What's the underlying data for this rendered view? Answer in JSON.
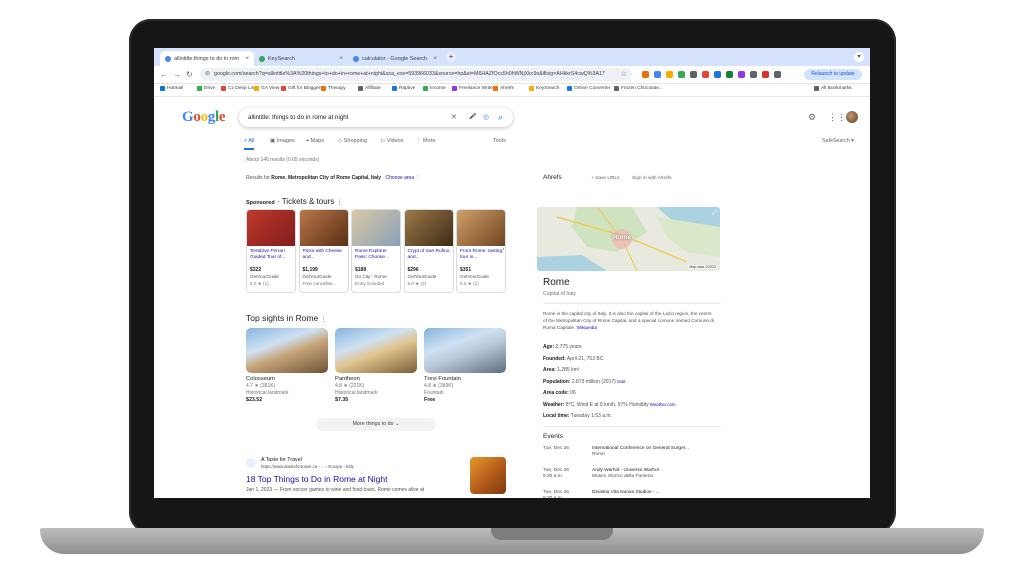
{
  "browser": {
    "tabs": [
      {
        "label": "allintitle:things to do in rom",
        "color": "#4285f4"
      },
      {
        "label": "KeySearch",
        "color": "#34a853"
      },
      {
        "label": "calculator - Google Search",
        "color": "#4285f4"
      }
    ],
    "tab_close": "×",
    "new_tab": "+",
    "url": "google.com/search?q=allintitle%3A%20things+to+do+in+rome+at+night&sca_esv=593966033&source=hp&ei=M6HAZfOcs5h0hWNjXkc9s&iflsig=AHkkrS4cwQ%3A17",
    "back": "←",
    "forward": "→",
    "reload": "↻",
    "lock": "⊜",
    "star": "☆",
    "relaunch_label": "Relaunch to update",
    "extension_colors": [
      "#e8710a",
      "#4285f4",
      "#f9ab00",
      "#34a853",
      "#5f6368",
      "#ea4335",
      "#1a73e8",
      "#188038",
      "#9334e6",
      "#5f6368",
      "#d93025",
      "#5f6368"
    ]
  },
  "bookmarks": [
    {
      "label": "Hotmail",
      "color": "#0078d4"
    },
    {
      "label": "Drive",
      "color": "#34a853"
    },
    {
      "label": "Cz Deep Link",
      "color": "#ea4335"
    },
    {
      "label": "GA View",
      "color": "#f9ab00"
    },
    {
      "label": "Gift for Bloggers",
      "color": "#ea4335"
    },
    {
      "label": "Therapy",
      "color": "#e8710a"
    },
    {
      "label": "Affiliate",
      "color": "#5f6368"
    },
    {
      "label": "Raptive",
      "color": "#1a73e8"
    },
    {
      "label": "Income",
      "color": "#34a853"
    },
    {
      "label": "Freelance Writers",
      "color": "#9334e6"
    },
    {
      "label": "Ahrefs",
      "color": "#ff6b00"
    },
    {
      "label": "KeySearch",
      "color": "#f9ab00"
    },
    {
      "label": "Online Converter",
      "color": "#1a73e8"
    },
    {
      "label": "Frozen Chocolate...",
      "color": "#5f6368"
    }
  ],
  "all_bookmarks": "All Bookmarks",
  "google": {
    "logo": [
      {
        "ch": "G",
        "c": "#4285f4"
      },
      {
        "ch": "o",
        "c": "#ea4335"
      },
      {
        "ch": "o",
        "c": "#fbbc05"
      },
      {
        "ch": "g",
        "c": "#4285f4"
      },
      {
        "ch": "l",
        "c": "#34a853"
      },
      {
        "ch": "e",
        "c": "#ea4335"
      }
    ],
    "query": "allintitle: things to do in rome at night",
    "clear_icon": "✕",
    "mic_icon": "🎤",
    "lens_icon": "◎",
    "search_icon": "⌕",
    "settings_icon": "⚙",
    "apps_icon": "⋮⋮",
    "tabs": [
      {
        "label": "All",
        "active": true
      },
      {
        "label": "Images"
      },
      {
        "label": "Maps"
      },
      {
        "label": "Shopping"
      },
      {
        "label": "Videos"
      },
      {
        "label": "More"
      }
    ],
    "tools": "Tools",
    "safesearch": "SafeSearch ▾",
    "stats": "About 146 results (0.65 seconds)",
    "results_for_prefix": "Results for ",
    "results_for_place": "Rome, Metropolitan City of Rome Capital, Italy",
    "choose_area": "Choose area",
    "sponsored_label": "Sponsored",
    "tickets_title": "Tickets & tours",
    "tickets": [
      {
        "title": "Testdrive Ferrari Guided Tour of...",
        "price": "$322",
        "vendor": "GetYourGuide",
        "rating": "5.0 ★ (1)",
        "c1": "#c0392b",
        "c2": "#7f1d1d"
      },
      {
        "title": "Pizza with Cheese and...",
        "price": "$1,199",
        "vendor": "GetYourGuide",
        "rating": "Free cancellati...",
        "c1": "#b9774a",
        "c2": "#5a2e14"
      },
      {
        "title": "Rome Explorer Pass: Choose...",
        "price": "$188",
        "vendor": "Go City - Rome",
        "rating": "Entry included",
        "c1": "#d9c9a6",
        "c2": "#8aa0b6"
      },
      {
        "title": "Crypt of San Rufino and...",
        "price": "$296",
        "vendor": "GetYourGuide",
        "rating": "5.0 ★ (2)",
        "c1": "#9c7a4a",
        "c2": "#3f2c17"
      },
      {
        "title": "From Rome: tasting tour in...",
        "price": "$351",
        "vendor": "GetYourGuide",
        "rating": "5.0 ★ (1)",
        "c1": "#d1a06a",
        "c2": "#6e4421"
      }
    ],
    "tickets_next": "›",
    "sights_title": "Top sights in Rome",
    "sights": [
      {
        "name": "Colosseum",
        "rating": "4.7 ★ (381K)",
        "kind": "Historical landmark",
        "cost": "$23.52",
        "c1": "#c7a57a",
        "c2": "#6d5236"
      },
      {
        "name": "Pantheon",
        "rating": "4.8 ★ (221K)",
        "kind": "Historical landmark",
        "cost": "$7.35",
        "c1": "#e0c48e",
        "c2": "#7a5d34"
      },
      {
        "name": "Trevi Fountain",
        "rating": "4.8 ★ (389K)",
        "kind": "Fountain",
        "cost": "Free",
        "c1": "#b8c8d8",
        "c2": "#5c6f80"
      }
    ],
    "more_things": "More things to do  ⌄",
    "result": {
      "site": "A Taste for Travel",
      "url": "https://www.atastefortravel.ca › ... › Europe › Italy",
      "title": "18 Top Things to Do in Rome at Night",
      "snippet": "Jan 1, 2023 — From soccer games to wine and food tours, Rome comes alive at"
    }
  },
  "panel": {
    "ahrefs": "Ahrefs",
    "save_urls": "+ Save URLs",
    "sign_in": "Sign in with Ahrefs",
    "map_label": "Rome",
    "map_credit": "Map data ©2023",
    "expand_icon": "⤢",
    "title": "Rome",
    "subtitle": "Capital of Italy",
    "description": "Rome is the capital city of Italy. It is also the capital of the Lazio region, the centre of the Metropolitan City of Rome Capital, and a special comune named Comune di Roma Capitale.",
    "wiki": "Wikipedia",
    "facts": [
      {
        "k": "Age:",
        "v": " 2,775 years"
      },
      {
        "k": "Founded:",
        "v": " April 21, 753 BC"
      },
      {
        "k": "Area:",
        "v": " 1,285 km²"
      },
      {
        "k": "Population:",
        "v": " 2.873 million (2017)",
        "link": " Istat"
      },
      {
        "k": "Area code:",
        "v": " 06"
      },
      {
        "k": "Weather:",
        "v": " 8°C, Wind E at 9 km/h, 97% Humidity",
        "link": " Weather.com"
      },
      {
        "k": "Local time:",
        "v": " Tuesday 1:53 a.m."
      }
    ],
    "events_title": "Events",
    "events": [
      {
        "date": "Tue, Dec 26",
        "time": "",
        "title": "International Conference on General Surger...",
        "place": "Rome"
      },
      {
        "date": "Tue, Dec 26",
        "time": "9:30 a.m.",
        "title": "Andy Warhol - Universo Warhol",
        "place": "Museo Storico della Fanteria"
      },
      {
        "date": "Tue, Dec 26",
        "time": "9:30 a.m.",
        "title": "Dinastia Vita Nuova Studios - ...",
        "place": ""
      }
    ]
  }
}
